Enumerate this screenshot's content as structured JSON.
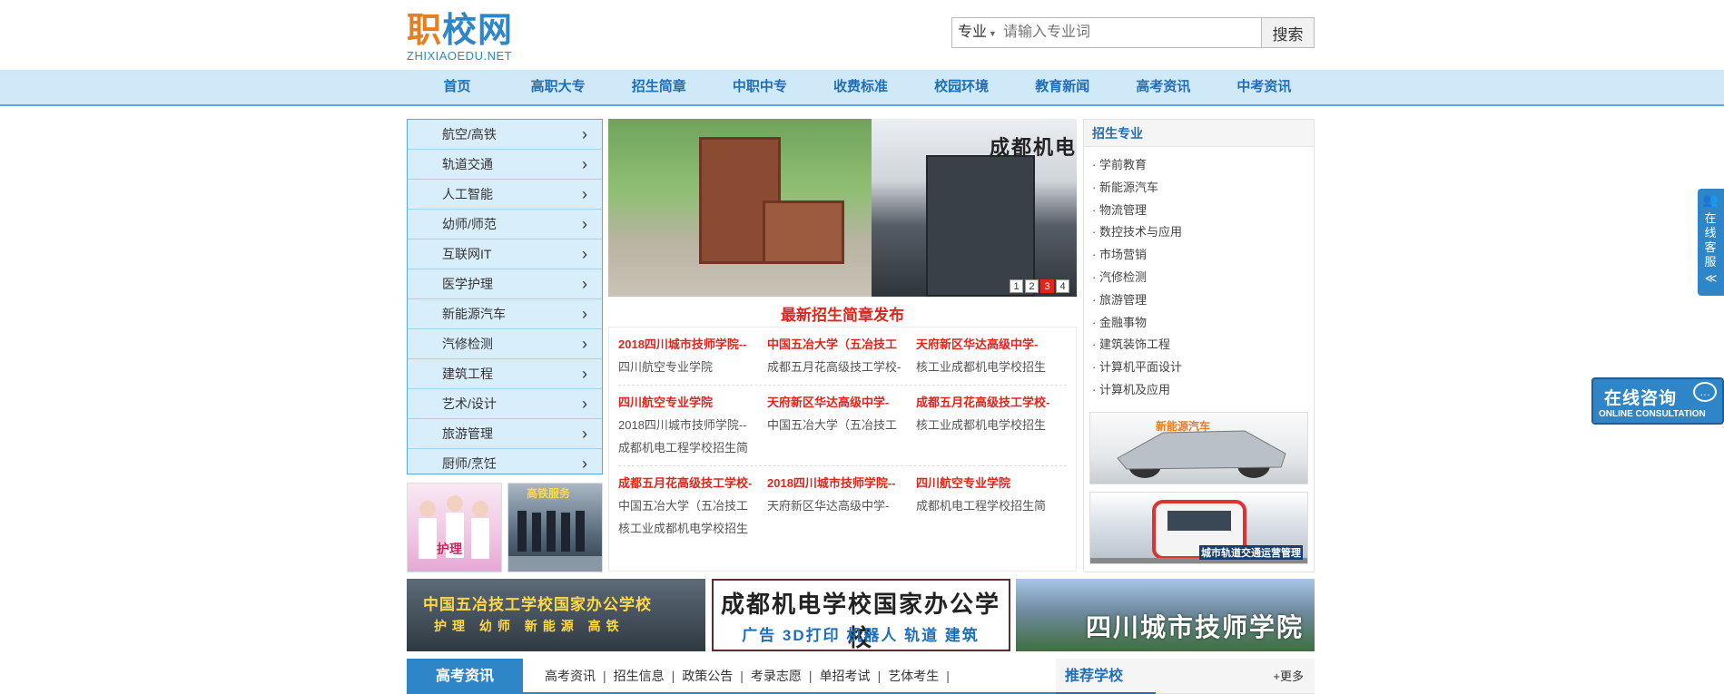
{
  "logo": {
    "part1": "职",
    "part2": "校网",
    "sub": "ZHIXIAOEDU.NET"
  },
  "search": {
    "category": "专业",
    "placeholder": "请输入专业词",
    "button": "搜索"
  },
  "nav": [
    "首页",
    "高职大专",
    "招生简章",
    "中职中专",
    "收费标准",
    "校园环境",
    "教育新闻",
    "高考资讯",
    "中考资讯"
  ],
  "left_menu": [
    "航空/高铁",
    "轨道交通",
    "人工智能",
    "幼师/师范",
    "互联网IT",
    "医学护理",
    "新能源汽车",
    "汽修检测",
    "建筑工程",
    "艺术/设计",
    "旅游管理",
    "厨师/烹饪"
  ],
  "left_pics": {
    "pic1_label": "护理",
    "pic2_label": "高铁服务"
  },
  "banner": {
    "slide_title": "成都机电",
    "dots": [
      "1",
      "2",
      "3",
      "4"
    ],
    "active_dot": "3"
  },
  "news": {
    "heading": "最新招生简章发布",
    "groups": [
      [
        [
          "2018四川城市技师学院--",
          "四川航空专业学院"
        ],
        [
          "中国五冶大学（五冶技工",
          "成都五月花高级技工学校-"
        ],
        [
          "天府新区华达高级中学-",
          "核工业成都机电学校招生"
        ]
      ],
      [
        [
          "四川航空专业学院",
          "2018四川城市技师学院--",
          "成都机电工程学校招生简"
        ],
        [
          "天府新区华达高级中学-",
          "中国五冶大学（五冶技工"
        ],
        [
          "成都五月花高级技工学校-",
          "核工业成都机电学校招生"
        ]
      ],
      [
        [
          "成都五月花高级技工学校-",
          "中国五冶大学（五冶技工",
          "核工业成都机电学校招生"
        ],
        [
          "2018四川城市技师学院--",
          "天府新区华达高级中学-"
        ],
        [
          "四川航空专业学院",
          "成都机电工程学校招生简"
        ]
      ]
    ]
  },
  "majors": {
    "title": "招生专业",
    "items": [
      "学前教育",
      "新能源汽车",
      "物流管理",
      "数控技术与应用",
      "市场营销",
      "汽修检测",
      "旅游管理",
      "金融事物",
      "建筑装饰工程",
      "计算机平面设计",
      "计算机及应用"
    ],
    "img1_label": "新能源汽车",
    "img2_label": "城市轨道交通运营管理"
  },
  "ads": {
    "ad1_line1": "中国五冶技工学校国家办公学校",
    "ad1_line2": "护理 幼师 新能源 高铁",
    "ad2_line1": "成都机电学校国家办公学校",
    "ad2_line2": "广告 3D打印 机器人 轨道 建筑",
    "ad3_line1": "四川城市技师学院"
  },
  "gaokao": {
    "tab": "高考资讯",
    "links": [
      "高考资讯",
      "招生信息",
      "政策公告",
      "考录志愿",
      "单招考试",
      "艺体考生"
    ]
  },
  "recommend": {
    "title": "推荐学校",
    "more": "+更多"
  },
  "float": {
    "kefu_text": "在线客服",
    "kefu_arrow": "≪",
    "consult_cn": "在线咨询",
    "consult_en": "ONLINE CONSULTATION"
  },
  "colors": {
    "brand_blue": "#2e86c9",
    "accent_orange": "#e67e22",
    "news_red": "#e1251b",
    "nav_bg": "#cfe9f8"
  }
}
